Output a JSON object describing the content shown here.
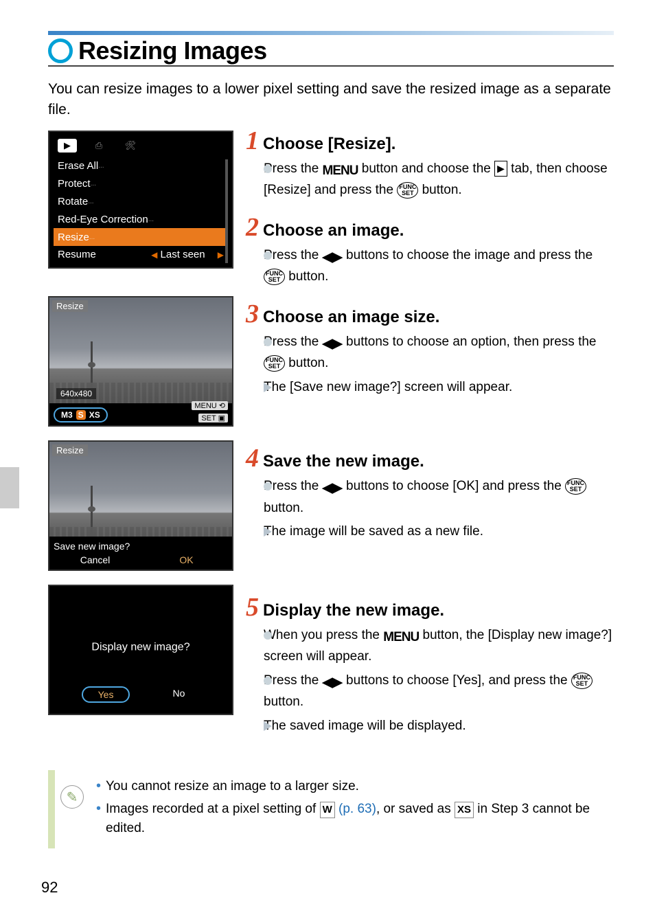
{
  "title": "Resizing Images",
  "intro": "You can resize images to a lower pixel setting and save the resized image as a separate file.",
  "menu": {
    "items": [
      "Erase All",
      "Protect",
      "Rotate",
      "Red-Eye Correction",
      "Resize",
      "Resume"
    ],
    "last_seen": "Last seen"
  },
  "shot_resize": {
    "label": "Resize",
    "resolution": "640x480",
    "sizes": [
      "M3",
      "S",
      "XS"
    ],
    "menu": "MENU",
    "set": "SET"
  },
  "shot_save": {
    "label": "Resize",
    "question": "Save new image?",
    "cancel": "Cancel",
    "ok": "OK"
  },
  "shot_display": {
    "question": "Display new image?",
    "yes": "Yes",
    "no": "No"
  },
  "steps": [
    {
      "num": "1",
      "title": "Choose [Resize].",
      "b1a": "Press the ",
      "b1b": " button and choose the ",
      "b1c": " tab, then choose [Resize] and press the ",
      "b1d": " button."
    },
    {
      "num": "2",
      "title": "Choose an image.",
      "b1a": "Press the ",
      "b1b": " buttons to choose the image and press the ",
      "b1c": " button."
    },
    {
      "num": "3",
      "title": "Choose an image size.",
      "b1a": "Press the ",
      "b1b": " buttons to choose an option, then press the ",
      "b1c": " button.",
      "t1": "The [Save new image?] screen will appear."
    },
    {
      "num": "4",
      "title": "Save the new image.",
      "b1a": "Press the ",
      "b1b": " buttons to choose [OK] and press the ",
      "b1c": " button.",
      "t1": "The image will be saved as a new file."
    },
    {
      "num": "5",
      "title": "Display the new image.",
      "b1a": "When you press the ",
      "b1b": " button, the [Display new image?] screen will appear.",
      "b2a": "Press the ",
      "b2b": " buttons to choose [Yes], and press the ",
      "b2c": " button.",
      "t1": "The saved image will be displayed."
    }
  ],
  "notes": {
    "n1": "You cannot resize an image to a larger size.",
    "n2a": "Images recorded at a pixel setting of ",
    "n2b": " (p. 63)",
    "n2c": ", or saved as ",
    "n2d": " in Step 3 cannot be edited."
  },
  "icons": {
    "menu": "MENU",
    "func": "FUNC\nSET",
    "lr": "◀▶",
    "play": "▶",
    "w": "W",
    "xs": "XS"
  },
  "page": "92"
}
